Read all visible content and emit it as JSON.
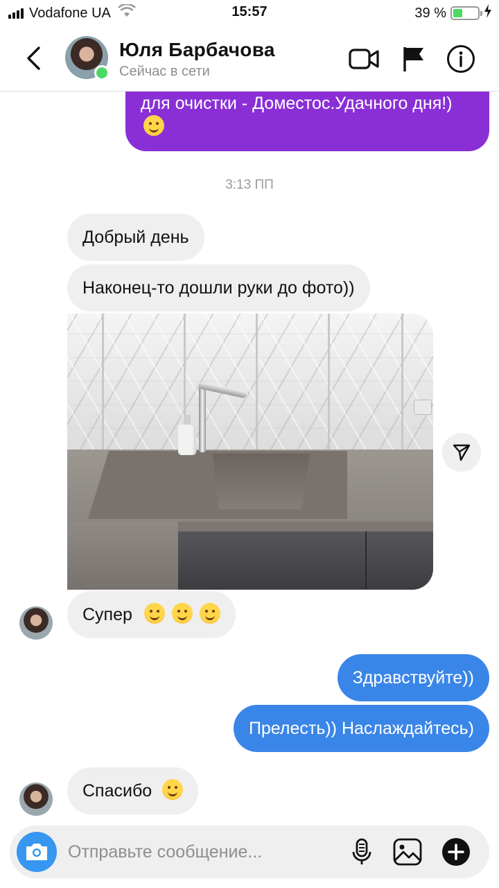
{
  "status_bar": {
    "carrier": "Vodafone UA",
    "time": "15:57",
    "battery": "39 %",
    "battery_level": 0.39
  },
  "header": {
    "name": "Юля Барбачова",
    "status": "Сейчас в сети",
    "icons": [
      "back-arrow-icon",
      "video-call-icon",
      "flag-icon",
      "info-icon"
    ]
  },
  "chat": {
    "prev_message": "для очистки - Доместос.Удачного дня!)",
    "timestamp": "3:13 ПП",
    "messages": [
      {
        "from": "them",
        "text": "Добрый день"
      },
      {
        "from": "them",
        "text": "Наконец-то дошли руки до фото))"
      },
      {
        "from": "them",
        "type": "photo"
      },
      {
        "from": "them",
        "text": "Супер"
      },
      {
        "from": "me",
        "text": "Здравствуйте))"
      },
      {
        "from": "me",
        "text": "Прелесть)) Наслаждайтесь)"
      },
      {
        "from": "them",
        "text": "Спасибо"
      }
    ]
  },
  "composer": {
    "placeholder": "Отправьте сообщение..."
  },
  "colors": {
    "outgoing_purple": "#8a2fd6",
    "outgoing_blue": "#3a86e8",
    "incoming": "#efefef",
    "accent": "#3797f0",
    "online": "#4cd964"
  }
}
